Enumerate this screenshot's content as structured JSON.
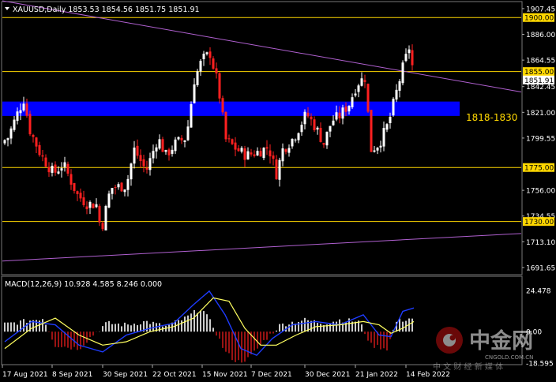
{
  "header": {
    "symbol_line": "XAUUSD,Daily  1853.53 1854.56 1851.75 1851.91",
    "macd_line": "MACD(12,26,9) 10.928 4.585 8.246 0.000"
  },
  "price_axis": {
    "ticks": [
      "1907.45",
      "1886.00",
      "1864.55",
      "1842.45",
      "1821.00",
      "1799.55",
      "1756.00",
      "1734.55",
      "1713.10",
      "1691.65"
    ],
    "tick_values": [
      1907.45,
      1886.0,
      1864.55,
      1842.45,
      1821.0,
      1799.55,
      1756.0,
      1734.55,
      1713.1,
      1691.65
    ],
    "current_price_label": "1851.91",
    "current_price": 1851.91,
    "range": [
      1687,
      1912
    ]
  },
  "levels": [
    {
      "label": "1900.00",
      "value": 1900.0
    },
    {
      "label": "1855.00",
      "value": 1855.0
    },
    {
      "label": "1775.00",
      "value": 1775.0
    },
    {
      "label": "1730.00",
      "value": 1730.0
    }
  ],
  "zone": {
    "label": "1818-1830",
    "low": 1818,
    "high": 1830
  },
  "macd_axis": {
    "ticks": [
      "24.478",
      "0.00",
      "-18.595"
    ],
    "tick_values": [
      24.478,
      0,
      -18.595
    ]
  },
  "date_axis": [
    "17 Aug 2021",
    "8 Sep 2021",
    "30 Sep 2021",
    "22 Oct 2021",
    "15 Nov 2021",
    "7 Dec 2021",
    "30 Dec 2021",
    "21 Jan 2022",
    "14 Feb 2022"
  ],
  "watermark": {
    "brand": "中金网",
    "domain": "CNGOLD.COM.CN",
    "tagline": "中 文 财 经 新 媒 体"
  },
  "colors": {
    "background": "#000000",
    "bull": "#ffffff",
    "bear": "#ff2020",
    "level_line": "#ffd700",
    "zone": "#0000ff",
    "trendline": "#b060d0",
    "macd_main": "#1e3cff",
    "macd_signal": "#ffff60",
    "histogram_pos": "#ffffff",
    "histogram_neg": "#c01818"
  }
}
